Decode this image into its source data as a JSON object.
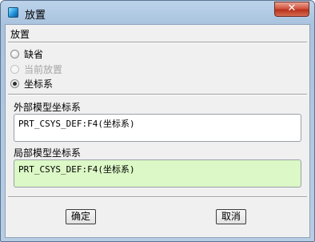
{
  "window": {
    "title": "放置",
    "close_glyph": "✕"
  },
  "placement": {
    "section_label": "放置",
    "options": [
      {
        "label": "缺省",
        "checked": false,
        "disabled": false
      },
      {
        "label": "当前放置",
        "checked": false,
        "disabled": true
      },
      {
        "label": "坐标系",
        "checked": true,
        "disabled": false
      }
    ]
  },
  "external_csys": {
    "label": "外部模型坐标系",
    "value": "PRT_CSYS_DEF:F4(坐标系)"
  },
  "local_csys": {
    "label": "局部模型坐标系",
    "value": "PRT_CSYS_DEF:F4(坐标系)"
  },
  "buttons": {
    "ok": "确定",
    "cancel": "取消"
  },
  "colors": {
    "local_field_bg": "#dcf8c6",
    "close_button": "#c8432c"
  }
}
